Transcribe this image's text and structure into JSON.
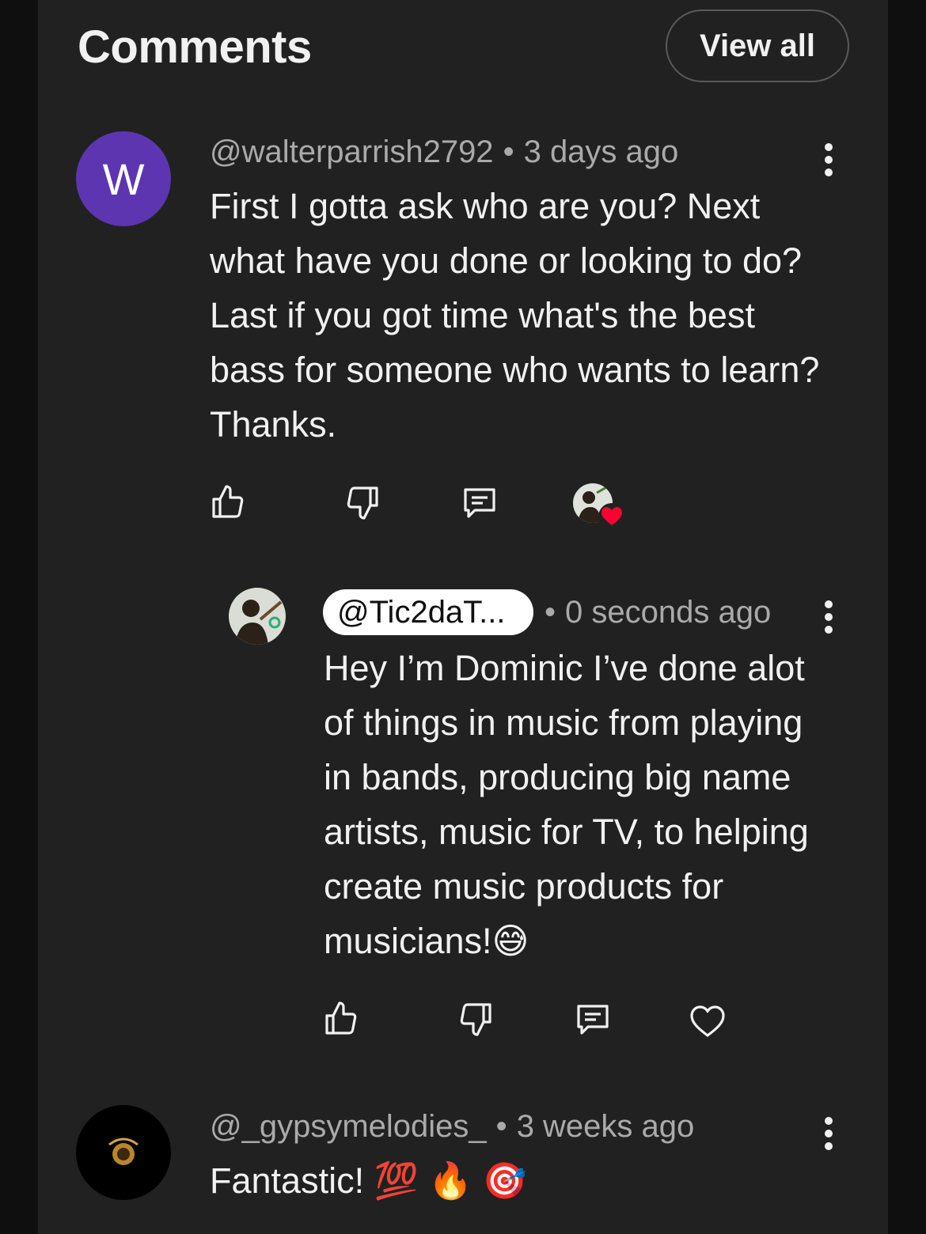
{
  "header": {
    "title": "Comments",
    "view_all_label": "View all"
  },
  "comments": [
    {
      "avatar_letter": "W",
      "avatar_color": "#5e35b1",
      "handle": "@walterparrish2792",
      "time": "3 days ago",
      "text": "First I gotta ask who are you? Next what have you done or looking to do? Last if you got time what's the best bass for someone who wants to learn? Thanks."
    },
    {
      "handle": "@_gypsymelodies_",
      "time": "3 weeks ago",
      "text": "Fantastic! 💯 🔥 🎯"
    }
  ],
  "reply": {
    "handle": "@Tic2daT...",
    "time": "0 seconds ago",
    "text": "Hey I’m Dominic I’ve done alot of things in music from playing in bands, producing big name artists, music for TV, to helping create music products for musicians!😅"
  },
  "separator": "•",
  "colors": {
    "background": "#212121",
    "text": "#f1f1f1",
    "secondary": "#aaaaaa",
    "heart": "#ff0033"
  },
  "icons": [
    "like-icon",
    "dislike-icon",
    "reply-icon",
    "more-vert-icon",
    "heart-icon"
  ]
}
